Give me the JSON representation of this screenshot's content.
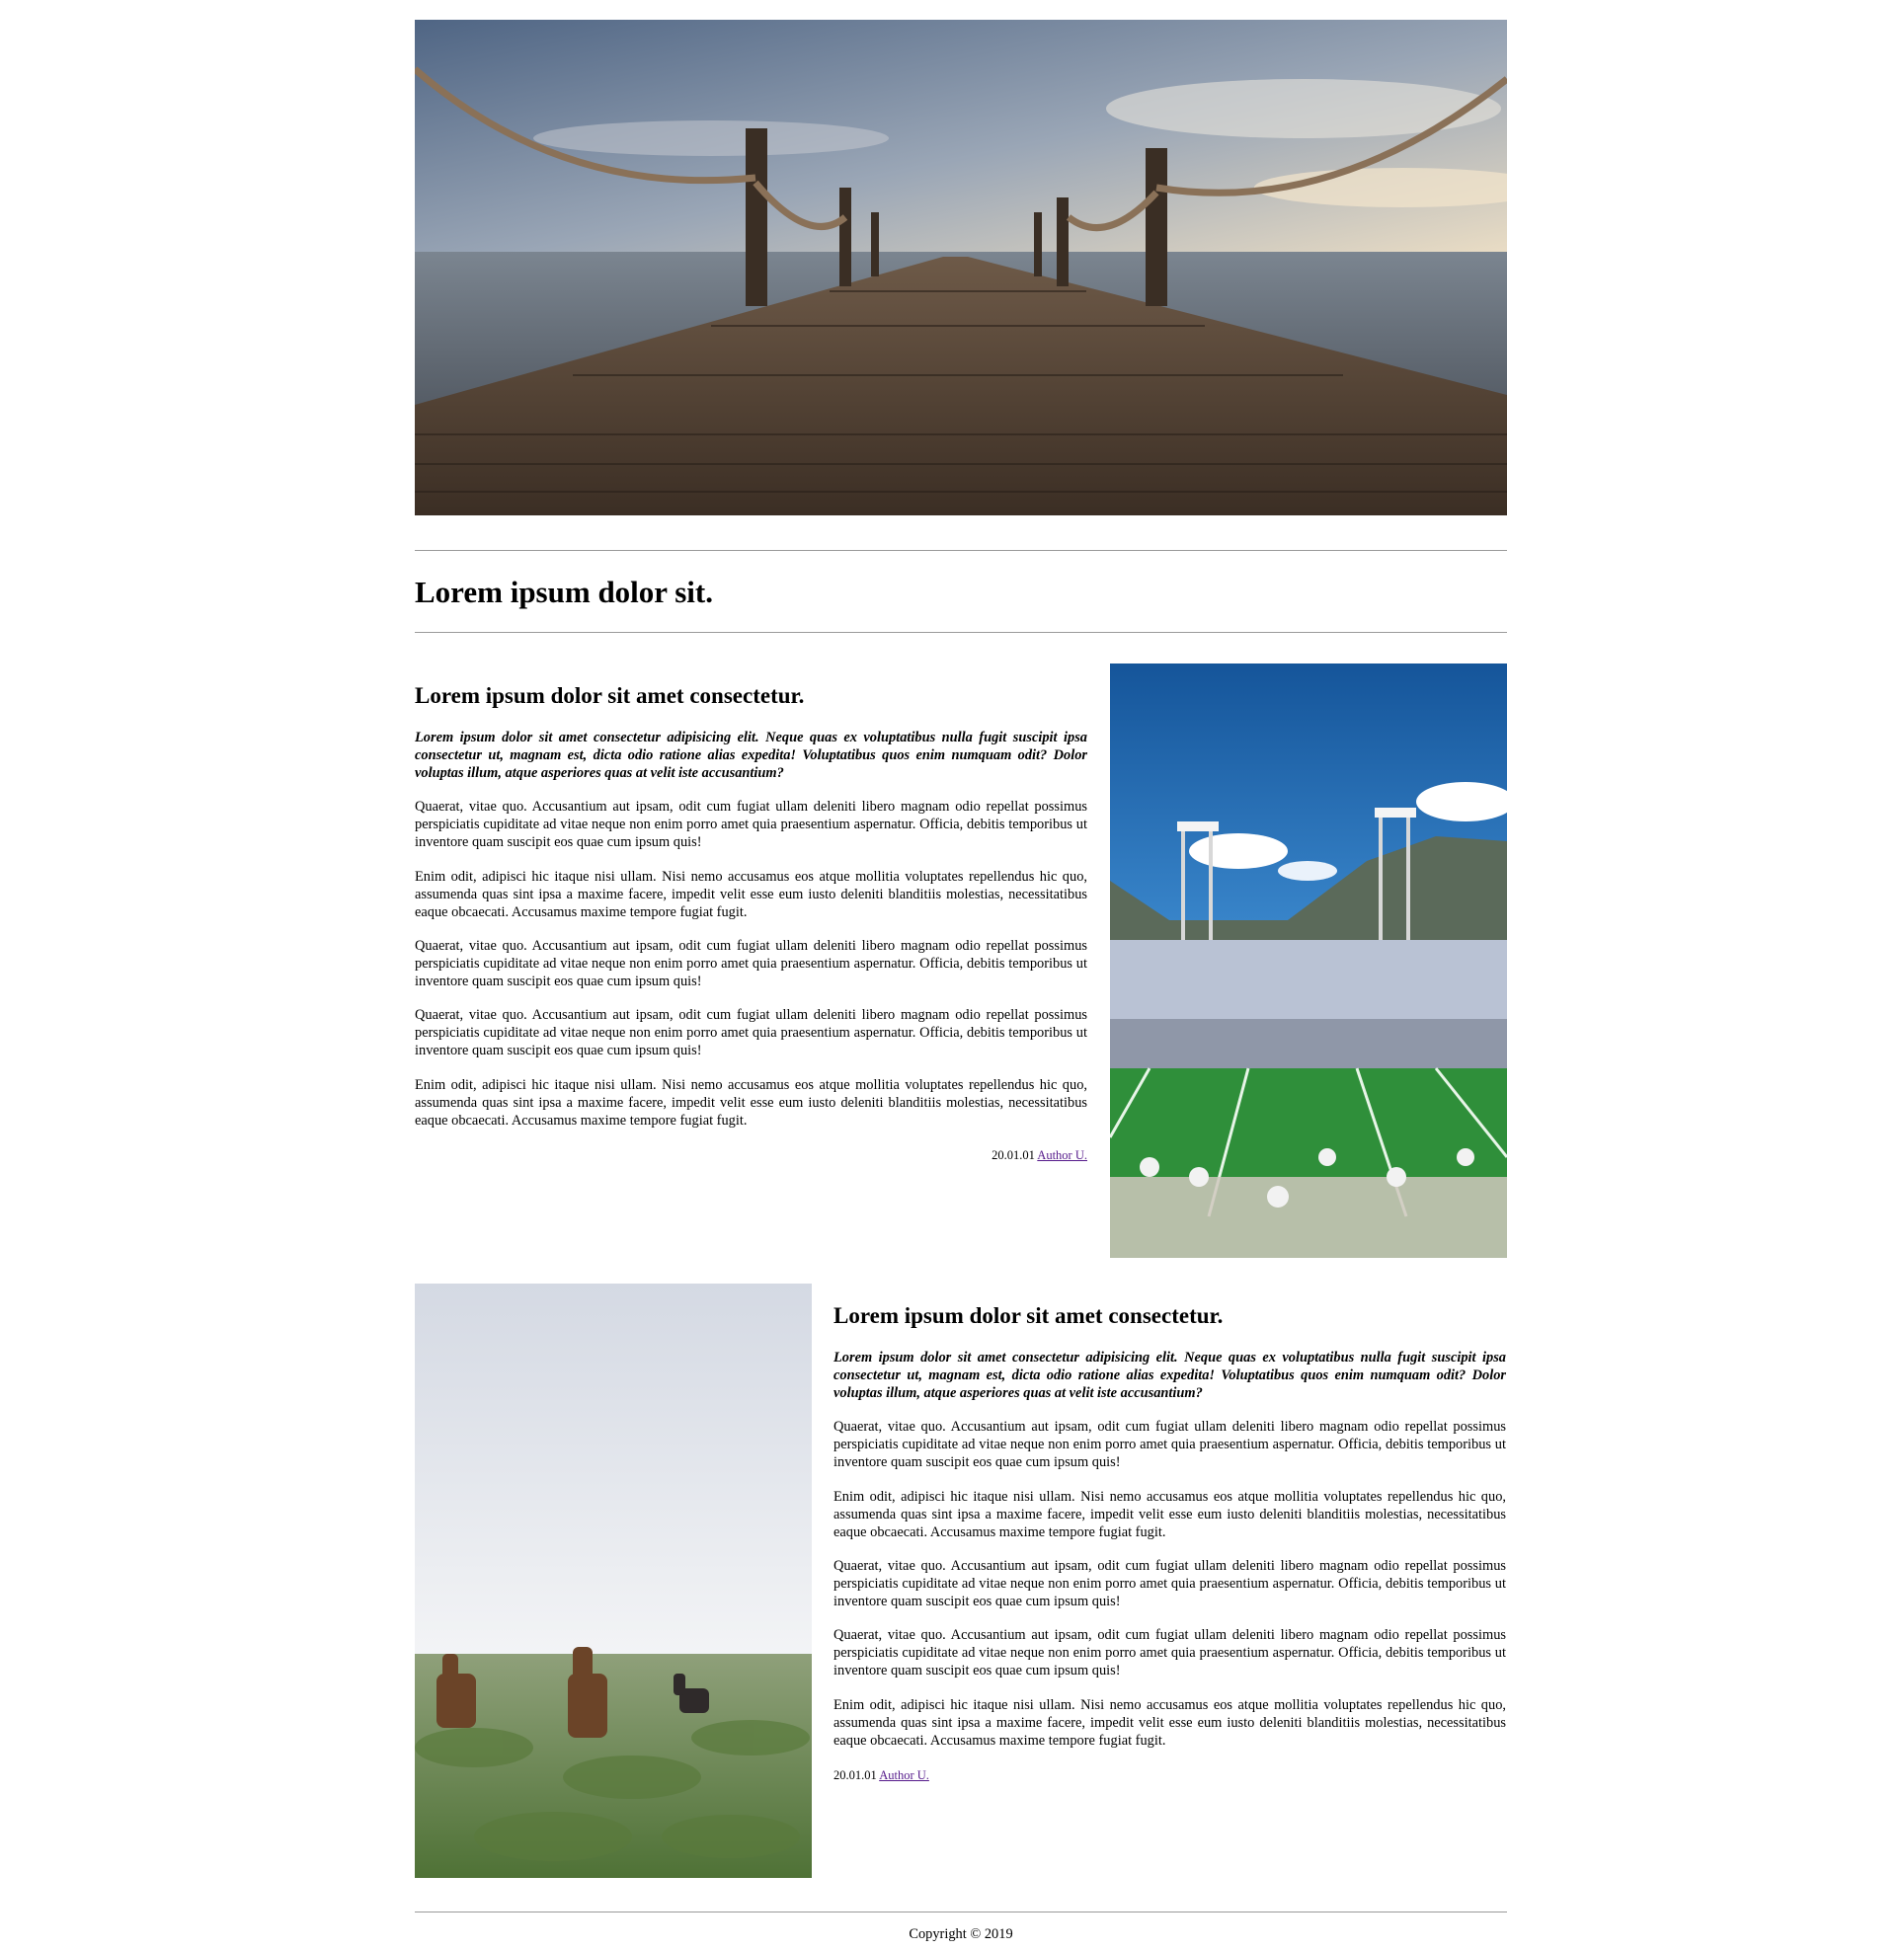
{
  "page": {
    "title": "Lorem ipsum dolor sit."
  },
  "hero": {
    "image": "pier-over-sea-photo"
  },
  "articles": [
    {
      "heading": "Lorem ipsum dolor sit amet consectetur.",
      "lead": "Lorem ipsum dolor sit amet consectetur adipisicing elit. Neque quas ex voluptatibus nulla fugit suscipit ipsa consectetur ut, magnam est, dicta odio ratione alias expedita! Voluptatibus quos enim numquam odit? Dolor voluptas illum, atque asperiores quas at velit iste accusantium?",
      "paragraphs": [
        "Quaerat, vitae quo. Accusantium aut ipsam, odit cum fugiat ullam deleniti libero magnam odio repellat possimus perspiciatis cupiditate ad vitae neque non enim porro amet quia praesentium aspernatur. Officia, debitis temporibus ut inventore quam suscipit eos quae cum ipsum quis!",
        "Enim odit, adipisci hic itaque nisi ullam. Nisi nemo accusamus eos atque mollitia voluptates repellendus hic quo, assumenda quas sint ipsa a maxime facere, impedit velit esse eum iusto deleniti blanditiis molestias, necessitatibus eaque obcaecati. Accusamus maxime tempore fugiat fugit.",
        "Quaerat, vitae quo. Accusantium aut ipsam, odit cum fugiat ullam deleniti libero magnam odio repellat possimus perspiciatis cupiditate ad vitae neque non enim porro amet quia praesentium aspernatur. Officia, debitis temporibus ut inventore quam suscipit eos quae cum ipsum quis!",
        "Quaerat, vitae quo. Accusantium aut ipsam, odit cum fugiat ullam deleniti libero magnam odio repellat possimus perspiciatis cupiditate ad vitae neque non enim porro amet quia praesentium aspernatur. Officia, debitis temporibus ut inventore quam suscipit eos quae cum ipsum quis!",
        "Enim odit, adipisci hic itaque nisi ullam. Nisi nemo accusamus eos atque mollitia voluptates repellendus hic quo, assumenda quas sint ipsa a maxime facere, impedit velit esse eum iusto deleniti blanditiis molestias, necessitatibus eaque obcaecati. Accusamus maxime tempore fugiat fugit."
      ],
      "date": "20.01.01",
      "author": "Author U.",
      "meta_align": "right",
      "image": "football-stadium-photo"
    },
    {
      "heading": "Lorem ipsum dolor sit amet consectetur.",
      "lead": "Lorem ipsum dolor sit amet consectetur adipisicing elit. Neque quas ex voluptatibus nulla fugit suscipit ipsa consectetur ut, magnam est, dicta odio ratione alias expedita! Voluptatibus quos enim numquam odit? Dolor voluptas illum, atque asperiores quas at velit iste accusantium?",
      "paragraphs": [
        "Quaerat, vitae quo. Accusantium aut ipsam, odit cum fugiat ullam deleniti libero magnam odio repellat possimus perspiciatis cupiditate ad vitae neque non enim porro amet quia praesentium aspernatur. Officia, debitis temporibus ut inventore quam suscipit eos quae cum ipsum quis!",
        "Enim odit, adipisci hic itaque nisi ullam. Nisi nemo accusamus eos atque mollitia voluptates repellendus hic quo, assumenda quas sint ipsa a maxime facere, impedit velit esse eum iusto deleniti blanditiis molestias, necessitatibus eaque obcaecati. Accusamus maxime tempore fugiat fugit.",
        "Quaerat, vitae quo. Accusantium aut ipsam, odit cum fugiat ullam deleniti libero magnam odio repellat possimus perspiciatis cupiditate ad vitae neque non enim porro amet quia praesentium aspernatur. Officia, debitis temporibus ut inventore quam suscipit eos quae cum ipsum quis!",
        "Quaerat, vitae quo. Accusantium aut ipsam, odit cum fugiat ullam deleniti libero magnam odio repellat possimus perspiciatis cupiditate ad vitae neque non enim porro amet quia praesentium aspernatur. Officia, debitis temporibus ut inventore quam suscipit eos quae cum ipsum quis!",
        "Enim odit, adipisci hic itaque nisi ullam. Nisi nemo accusamus eos atque mollitia voluptates repellendus hic quo, assumenda quas sint ipsa a maxime facere, impedit velit esse eum iusto deleniti blanditiis molestias, necessitatibus eaque obcaecati. Accusamus maxime tempore fugiat fugit."
      ],
      "date": "20.01.01",
      "author": "Author U.",
      "meta_align": "left",
      "image": "horses-grazing-photo"
    }
  ],
  "footer": {
    "copyright": "Copyright © 2019"
  },
  "colors": {
    "link": "#551a8b",
    "rule": "#9a9a9a"
  }
}
